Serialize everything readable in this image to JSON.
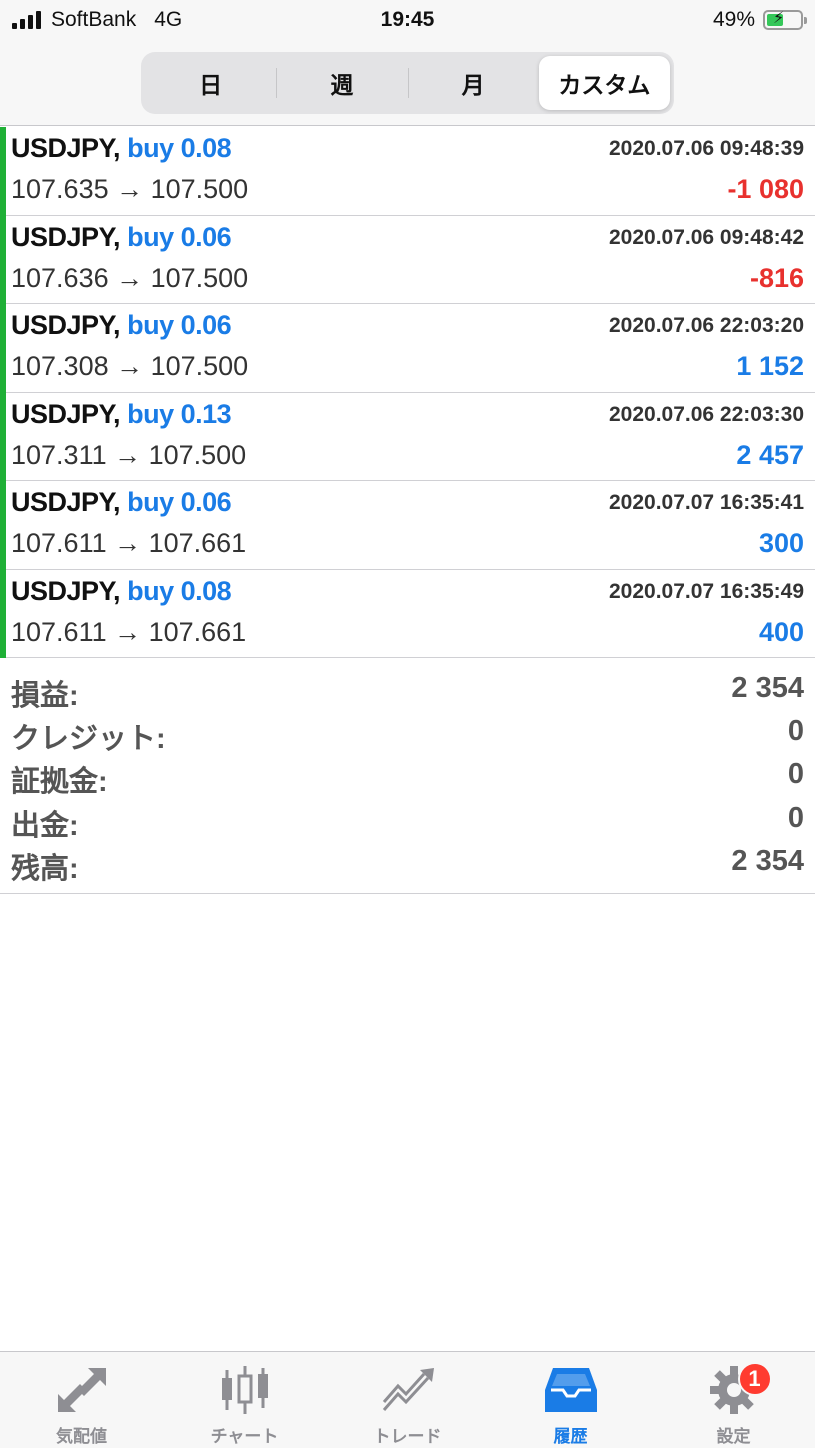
{
  "status_bar": {
    "carrier": "SoftBank",
    "network": "4G",
    "time": "19:45",
    "battery": "49%",
    "battery_level": 0.49
  },
  "period_tabs": [
    {
      "label": "日",
      "active": false
    },
    {
      "label": "週",
      "active": false
    },
    {
      "label": "月",
      "active": false
    },
    {
      "label": "カスタム",
      "active": true
    }
  ],
  "trades": [
    {
      "symbol": "USDJPY,",
      "type": "buy 0.08",
      "time": "2020.07.06 09:48:39",
      "prices": "107.635 → 107.500",
      "profit": "-1 080",
      "sign": "neg"
    },
    {
      "symbol": "USDJPY,",
      "type": "buy 0.06",
      "time": "2020.07.06 09:48:42",
      "prices": "107.636 → 107.500",
      "profit": "-816",
      "sign": "neg"
    },
    {
      "symbol": "USDJPY,",
      "type": "buy 0.06",
      "time": "2020.07.06 22:03:20",
      "prices": "107.308 → 107.500",
      "profit": "1 152",
      "sign": "pos"
    },
    {
      "symbol": "USDJPY,",
      "type": "buy 0.13",
      "time": "2020.07.06 22:03:30",
      "prices": "107.311 → 107.500",
      "profit": "2 457",
      "sign": "pos"
    },
    {
      "symbol": "USDJPY,",
      "type": "buy 0.06",
      "time": "2020.07.07 16:35:41",
      "prices": "107.611 → 107.661",
      "profit": "300",
      "sign": "pos"
    },
    {
      "symbol": "USDJPY,",
      "type": "buy 0.08",
      "time": "2020.07.07 16:35:49",
      "prices": "107.611 → 107.661",
      "profit": "400",
      "sign": "pos"
    }
  ],
  "summary": [
    {
      "label": "損益:",
      "value": "2 354"
    },
    {
      "label": "クレジット:",
      "value": "0"
    },
    {
      "label": "証拠金:",
      "value": "0"
    },
    {
      "label": "出金:",
      "value": "0"
    },
    {
      "label": "残高:",
      "value": "2 354"
    }
  ],
  "tabbar": [
    {
      "label": "気配値",
      "icon": "quotes-arrows-icon",
      "active": false
    },
    {
      "label": "チャート",
      "icon": "candlestick-chart-icon",
      "active": false
    },
    {
      "label": "トレード",
      "icon": "trade-trend-icon",
      "active": false
    },
    {
      "label": "履歴",
      "icon": "history-inbox-icon",
      "active": true
    },
    {
      "label": "設定",
      "icon": "gear-icon",
      "active": false,
      "badge": "1"
    }
  ],
  "colors": {
    "accent": "#1a7ce6",
    "loss": "#e8312e",
    "buy_bar": "#1fb036",
    "inactive": "#8e8e93"
  }
}
